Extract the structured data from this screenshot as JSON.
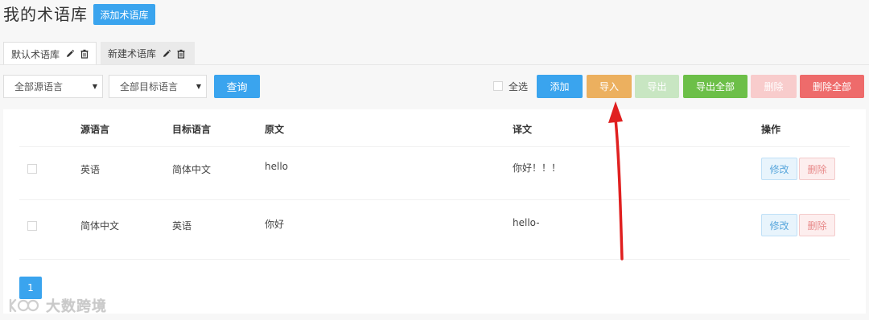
{
  "page": {
    "title": "我的术语库",
    "add_library_label": "添加术语库"
  },
  "tabs": [
    {
      "label": "默认术语库",
      "active": true,
      "icons": [
        "pencil-icon",
        "trash-icon"
      ]
    },
    {
      "label": "新建术语库",
      "active": false,
      "icons": [
        "pencil-icon",
        "trash-icon"
      ]
    }
  ],
  "filters": {
    "source_language": "全部源语言",
    "target_language": "全部目标语言",
    "query_label": "查询"
  },
  "toolbar": {
    "select_all_label": "全选",
    "add": "添加",
    "import": "导入",
    "export": "导出",
    "export_all": "导出全部",
    "delete": "删除",
    "delete_all": "删除全部"
  },
  "table": {
    "headers": {
      "source": "源语言",
      "target": "目标语言",
      "original": "原文",
      "translation": "译文",
      "actions": "操作"
    },
    "rows": [
      {
        "source": "英语",
        "target": "简体中文",
        "original": "hello",
        "translation": "你好！！！",
        "edit": "修改",
        "delete": "删除"
      },
      {
        "source": "简体中文",
        "target": "英语",
        "original": "你好",
        "translation": "hello-",
        "edit": "修改",
        "delete": "删除"
      }
    ]
  },
  "pagination": {
    "current_page": "1"
  },
  "watermark": {
    "text": "大数跨境"
  },
  "colors": {
    "primary": "#3aa4ee",
    "import": "#ecb05f",
    "export_disabled": "#c8e6c2",
    "export_all": "#6cbf48",
    "delete_disabled": "#f8cccc",
    "delete_all": "#ee6b6b",
    "annotation_arrow": "#e02020"
  }
}
